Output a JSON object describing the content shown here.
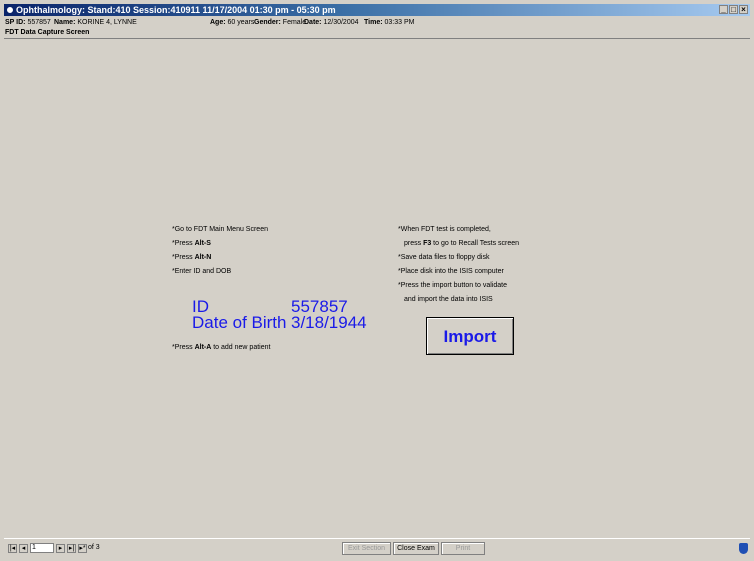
{
  "window": {
    "title": "Ophthalmology: Stand:410 Session:410911 11/17/2004 01:30 pm - 05:30 pm",
    "controls": [
      "_",
      "□",
      "×"
    ]
  },
  "patient": {
    "sp_id_label": "SP ID:",
    "sp_id": "557857",
    "name_label": "Name:",
    "name": "KORINE 4, LYNNE",
    "age_label": "Age:",
    "age": "60 years",
    "gender_label": "Gender:",
    "gender": "Female",
    "date_label": "Date:",
    "date": "12/30/2004",
    "time_label": "Time:",
    "time": "03:33 PM"
  },
  "screen_title": "FDT Data Capture Screen",
  "left_instructions": {
    "step1": "Go to FDT Main Menu Screen",
    "step2_prefix": "Press ",
    "step2_key": "Alt-S",
    "step3_prefix": "Press ",
    "step3_key": "Alt-N",
    "step4": "Enter ID and DOB",
    "step5_prefix": "Press ",
    "step5_key": "Alt-A",
    "step5_suffix": " to add new patient"
  },
  "right_instructions": {
    "step1": "When FDT test is completed,",
    "step1b_prefix": "press ",
    "step1b_key": "F3",
    "step1b_suffix": " to go to Recall Tests screen",
    "step2": "Save data files to floppy disk",
    "step3": "Place disk into the ISIS computer",
    "step4": "Press the import button to validate",
    "step4b": "and import the data into ISIS"
  },
  "bullet": "*",
  "id_block": {
    "id_label": "ID",
    "id_value": "557857",
    "dob_label": "Date of Birth",
    "dob_value": "3/18/1944"
  },
  "import_button": "Import",
  "bottom": {
    "page_current": "1",
    "page_of": "of 3",
    "exit_section": "Exit Section",
    "close_exam": "Close Exam",
    "print": "Print"
  }
}
